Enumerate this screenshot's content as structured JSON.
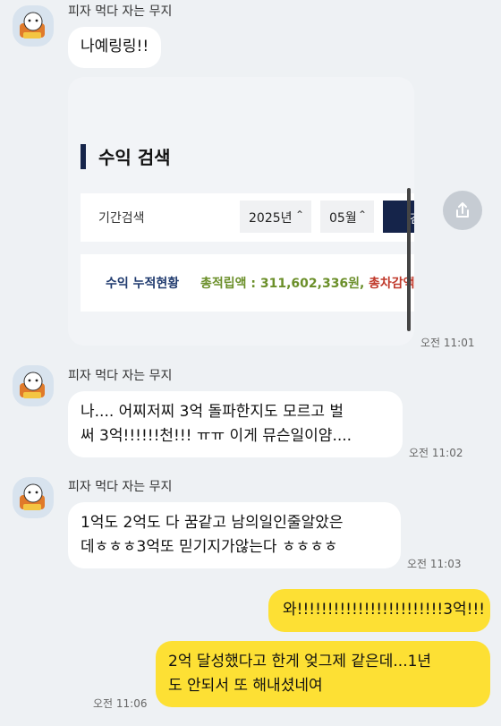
{
  "sender_name": "피자 먹다 자는 무지",
  "messages": [
    {
      "text": "나예링링!!"
    },
    {
      "line1": "나.... 어찌저찌 3억 돌파한지도 모르고 벌",
      "line2": "써 3억!!!!!!천!!! ㅠㅠ 이게 뮤슨일이얌....",
      "time": "오전 11:02"
    },
    {
      "line1": "1억도 2억도 다 꿈같고 남의일인줄알았은",
      "line2": "데ㅎㅎㅎ3억또 믿기지가않는다 ㅎㅎㅎㅎ",
      "time": "오전 11:03"
    }
  ],
  "image_time": "오전 11:01",
  "screenshot": {
    "heading": "수익 검색",
    "period_label": "기간검색",
    "year": "2025년",
    "month": "05월",
    "search_label": "검",
    "accum_label": "수익 누적현황",
    "total_text": "총적립액 : 311,602,336원,",
    "deduct_text": "총차감액",
    "accent": "#15244a"
  },
  "my_messages": [
    {
      "text": "와!!!!!!!!!!!!!!!!!!!!!!!!3억!!!"
    },
    {
      "line1": "2억 달성했다고 한게 엊그제 같은데...1년",
      "line2": "도 안되서 또 해내셨네여",
      "time": "오전 11:06"
    }
  ],
  "icons": {
    "share": "share-icon",
    "avatar": "muzi-avatar"
  },
  "colors": {
    "background": "#eef1f4",
    "my_bubble": "#fde034",
    "other_bubble": "#ffffff"
  }
}
